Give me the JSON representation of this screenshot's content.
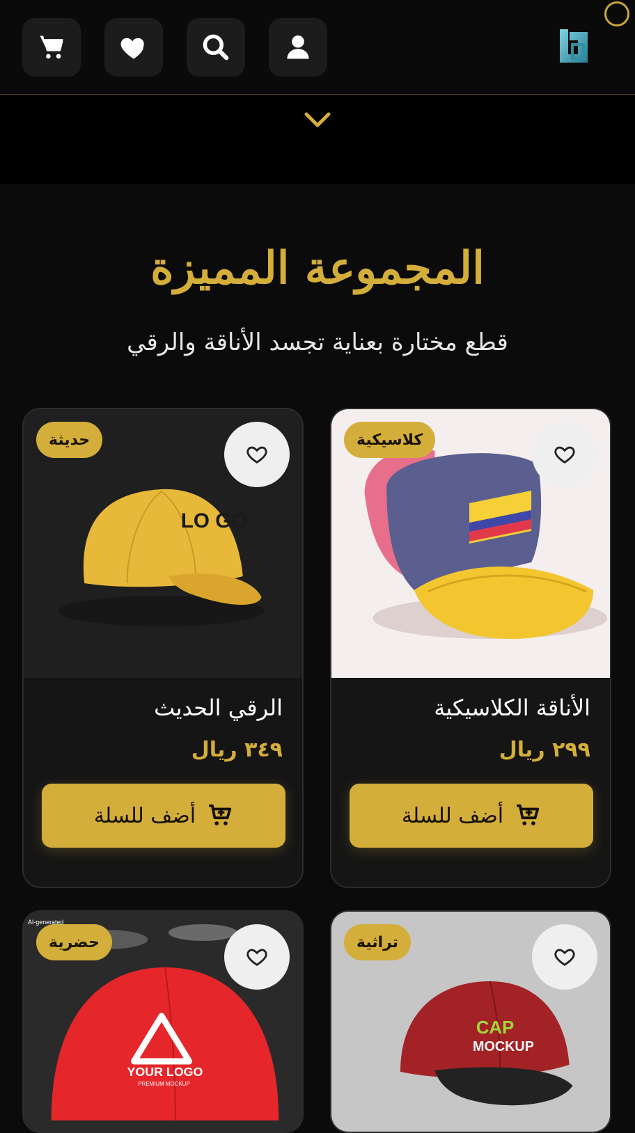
{
  "header": {
    "icons": [
      "cart-icon",
      "heart-icon",
      "search-icon",
      "user-icon"
    ],
    "brand_logo": "brand-logo"
  },
  "section": {
    "title": "المجموعة المميزة",
    "subtitle": "قطع مختارة بعناية تجسد الأناقة والرقي"
  },
  "products": [
    {
      "badge": "كلاسيكية",
      "name": "الأناقة الكلاسيكية",
      "price": "٢٩٩ ريال",
      "button": "أضف للسلة",
      "image": "cap-pink-blue-yellow"
    },
    {
      "badge": "حديثة",
      "name": "الرقي الحديث",
      "price": "٣٤٩ ريال",
      "button": "أضف للسلة",
      "image": "cap-yellow-logo"
    },
    {
      "badge": "تراثية",
      "name": "",
      "price": "",
      "button": "",
      "image": "cap-red-black-mockup"
    },
    {
      "badge": "حضرية",
      "name": "",
      "price": "",
      "button": "",
      "image": "cap-red-your-logo"
    }
  ],
  "image_overlays": {
    "cap_logo_text": "LO GO",
    "cap_mockup_text_1": "CAP",
    "cap_mockup_text_2": "MOCKUP",
    "red_cap_logo": "YOUR LOGO",
    "red_cap_sub": "PREMIUM MOCKUP",
    "ai_tag": "AI-generated"
  },
  "colors": {
    "accent": "#d4ae3a",
    "background": "#0b0b0b",
    "card": "#151515"
  }
}
